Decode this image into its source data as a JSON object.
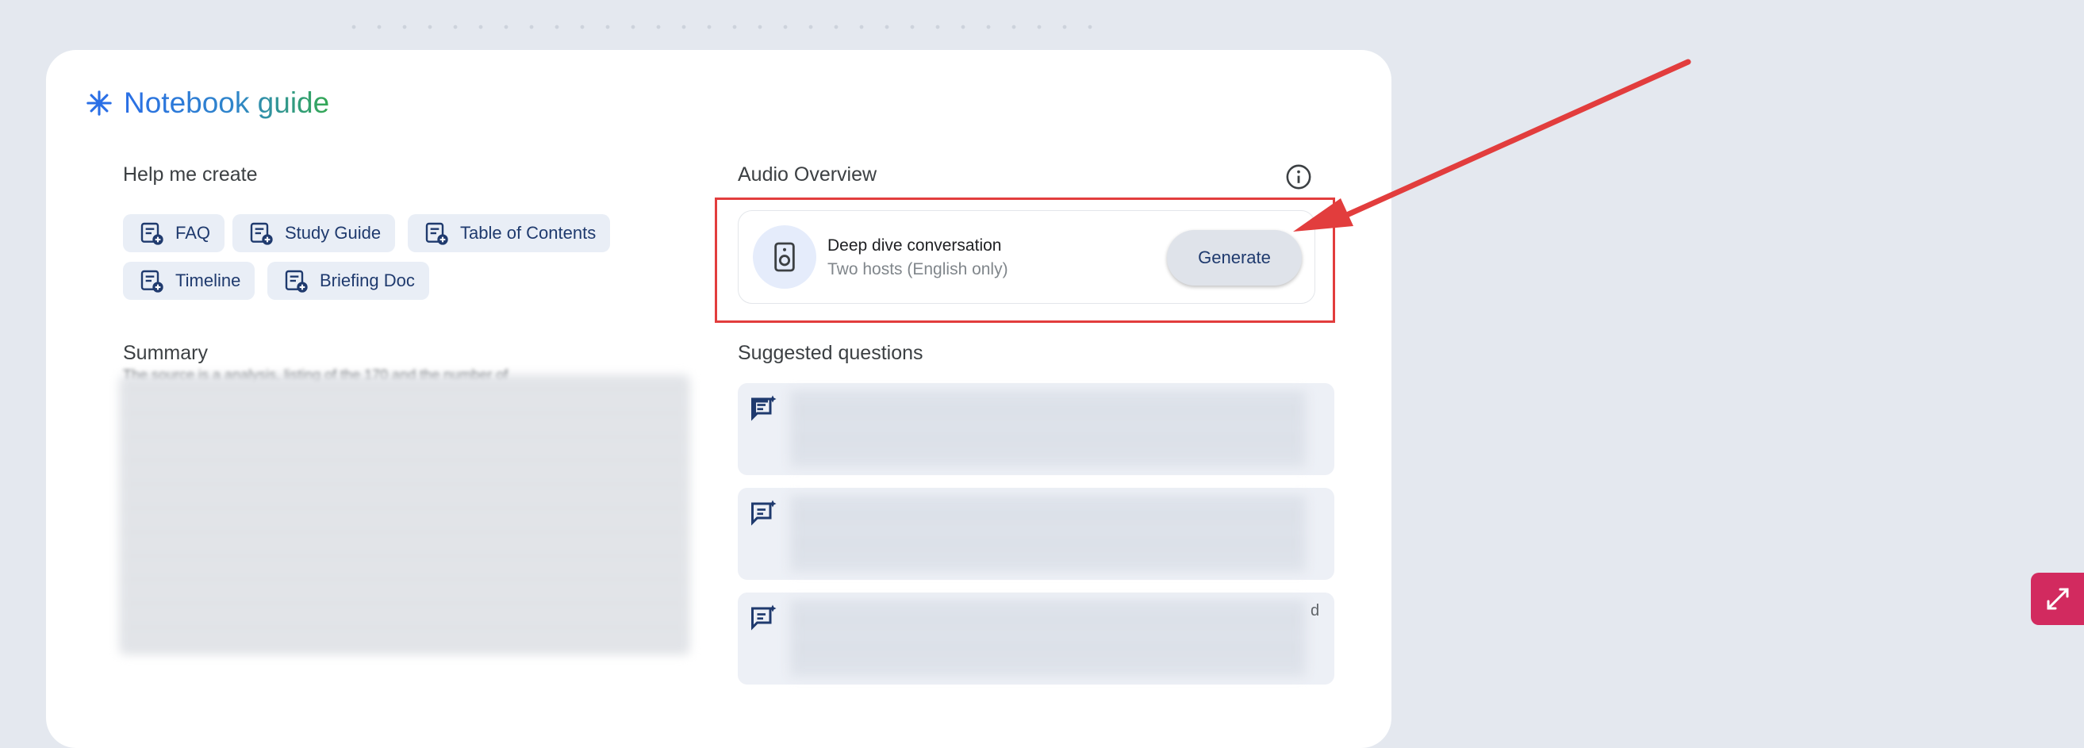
{
  "notebook_guide": {
    "title": "Notebook guide"
  },
  "help_me_create": {
    "label": "Help me create",
    "chips": [
      {
        "label": "FAQ"
      },
      {
        "label": "Study Guide"
      },
      {
        "label": "Table of Contents"
      },
      {
        "label": "Timeline"
      },
      {
        "label": "Briefing Doc"
      }
    ]
  },
  "summary": {
    "label": "Summary",
    "first_line": "The source is a analysis, listing of the 170 and the number of"
  },
  "audio_overview": {
    "label": "Audio Overview",
    "title": "Deep dive conversation",
    "subtitle": "Two hosts (English only)",
    "generate_label": "Generate"
  },
  "suggested_questions": {
    "label": "Suggested questions",
    "third_trailing": "d"
  },
  "colors": {
    "accent_blue": "#2a6fe6",
    "accent_green": "#34a853",
    "highlight_red": "#e23d3d",
    "side_button": "#d22a5f"
  },
  "icons": {
    "title": "sparkle-icon",
    "chip": "note-add-icon",
    "info": "info-icon",
    "audio": "speaker-icon",
    "question": "chat-spark-icon",
    "side": "expand-arrows-icon"
  }
}
